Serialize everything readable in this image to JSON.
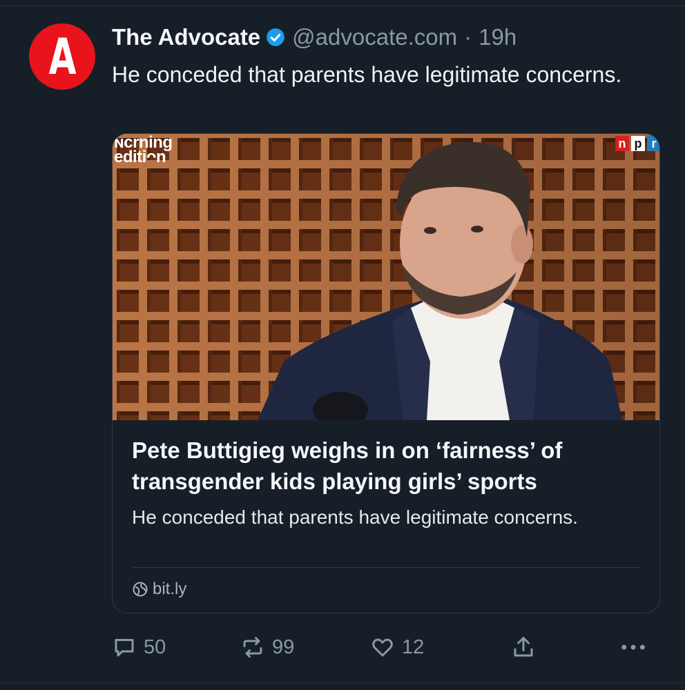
{
  "post": {
    "author": {
      "avatar_letter": "A",
      "display_name": "The Advocate",
      "verified": true,
      "handle": "@advocate.com",
      "separator": "·",
      "timestamp": "19h"
    },
    "text": "He conceded that parents have legitimate concerns."
  },
  "card": {
    "image": {
      "overlay_logo_line1": "ɴᴄrning",
      "overlay_logo_line2": "editiᴖn",
      "network_logo": [
        "n",
        "p",
        "r"
      ]
    },
    "title": "Pete Buttigieg weighs in on ‘fairness’ of transgender kids playing girls’ sports",
    "description": "He conceded that parents have legitimate concerns.",
    "domain": "bit.ly"
  },
  "actions": {
    "reply_count": "50",
    "repost_count": "99",
    "like_count": "12",
    "icons": [
      "reply-icon",
      "repost-icon",
      "like-icon",
      "share-icon",
      "more-icon"
    ]
  },
  "colors": {
    "background": "#161e27",
    "text": "#f1f3f5",
    "muted": "#8b98a5",
    "verified": "#1d9bf0",
    "avatar": "#e8131b"
  }
}
